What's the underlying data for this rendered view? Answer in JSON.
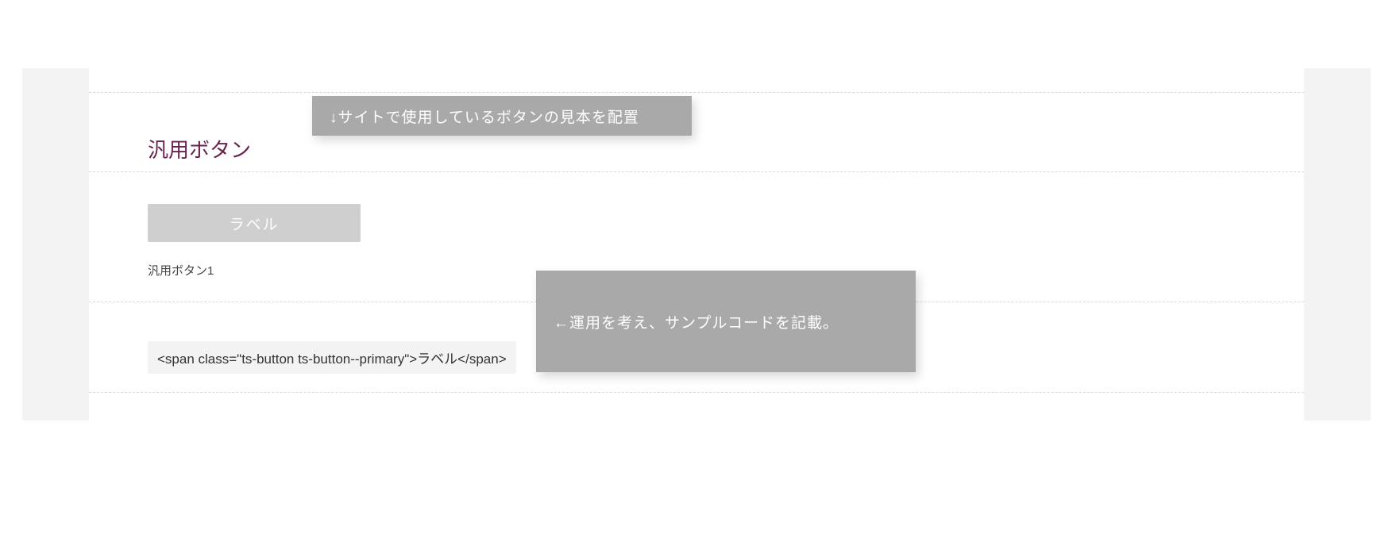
{
  "section": {
    "title": "汎用ボタン"
  },
  "annotations": {
    "top": "↓サイトで使用しているボタンの見本を配置",
    "middle": "←運用を考え、サンプルコードを記載。"
  },
  "sample_button": {
    "label": "ラベル",
    "caption": "汎用ボタン1"
  },
  "code_sample": {
    "text": "<span class=\"ts-button ts-button--primary\">ラベル</span>"
  }
}
